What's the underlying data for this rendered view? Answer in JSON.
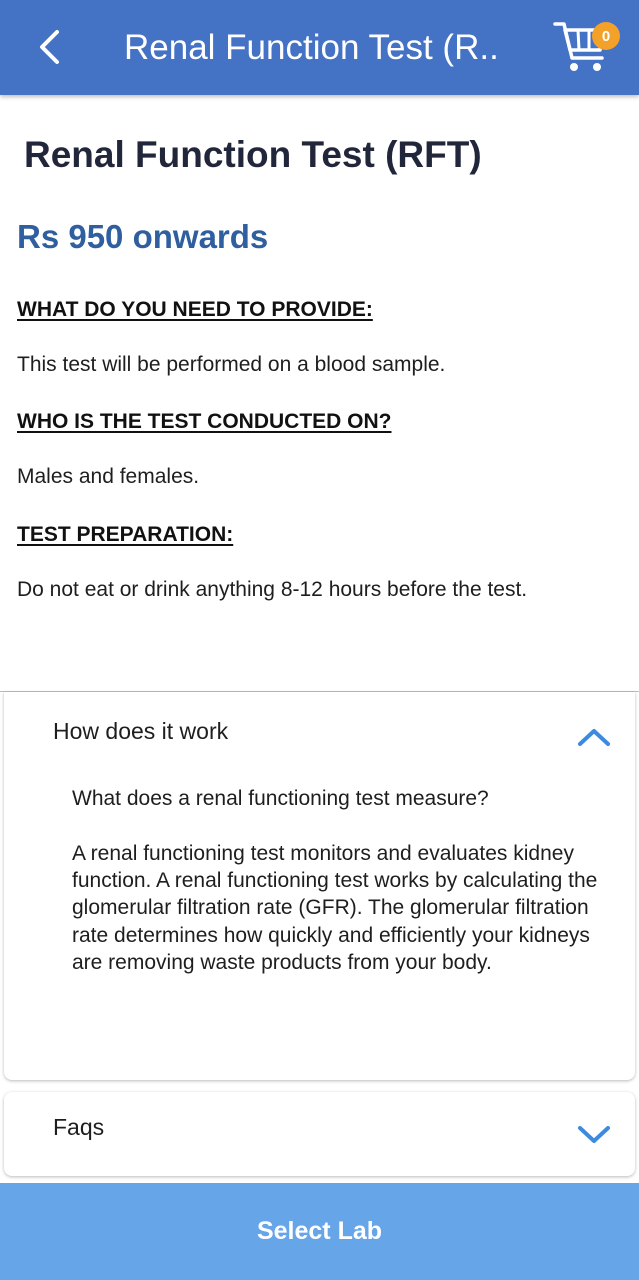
{
  "appbar": {
    "title": "Renal Function Test (R..",
    "back_icon": "chevron-left-icon",
    "cart_icon": "shopping-cart-icon",
    "cart_count": "0"
  },
  "test": {
    "title": "Renal Function Test (RFT)",
    "price": "Rs 950 onwards"
  },
  "sections": [
    {
      "heading": "WHAT DO YOU NEED TO PROVIDE:",
      "text": "This test will be performed on a blood sample."
    },
    {
      "heading": "WHO IS THE TEST CONDUCTED ON?",
      "text": "Males and females."
    },
    {
      "heading": "TEST PREPARATION:",
      "text": "Do not eat or drink anything 8-12 hours before the test."
    }
  ],
  "accordions": {
    "how": {
      "title": "How does it work",
      "state": "expanded",
      "question": "What does a renal functioning test measure?",
      "answer": "A renal functioning test monitors and evaluates kidney function. A renal functioning test works by calculating the glomerular filtration rate (GFR). The glomerular filtration rate determines how quickly and efficiently your kidneys are removing waste products from your body."
    },
    "faq": {
      "title": "Faqs",
      "state": "collapsed"
    }
  },
  "cta": {
    "label": "Select Lab"
  },
  "colors": {
    "appbar": "#4472c4",
    "price": "#2f5f9e",
    "badge": "#f4a12a",
    "cta": "#66a5e8",
    "chevron": "#3d8be0"
  }
}
